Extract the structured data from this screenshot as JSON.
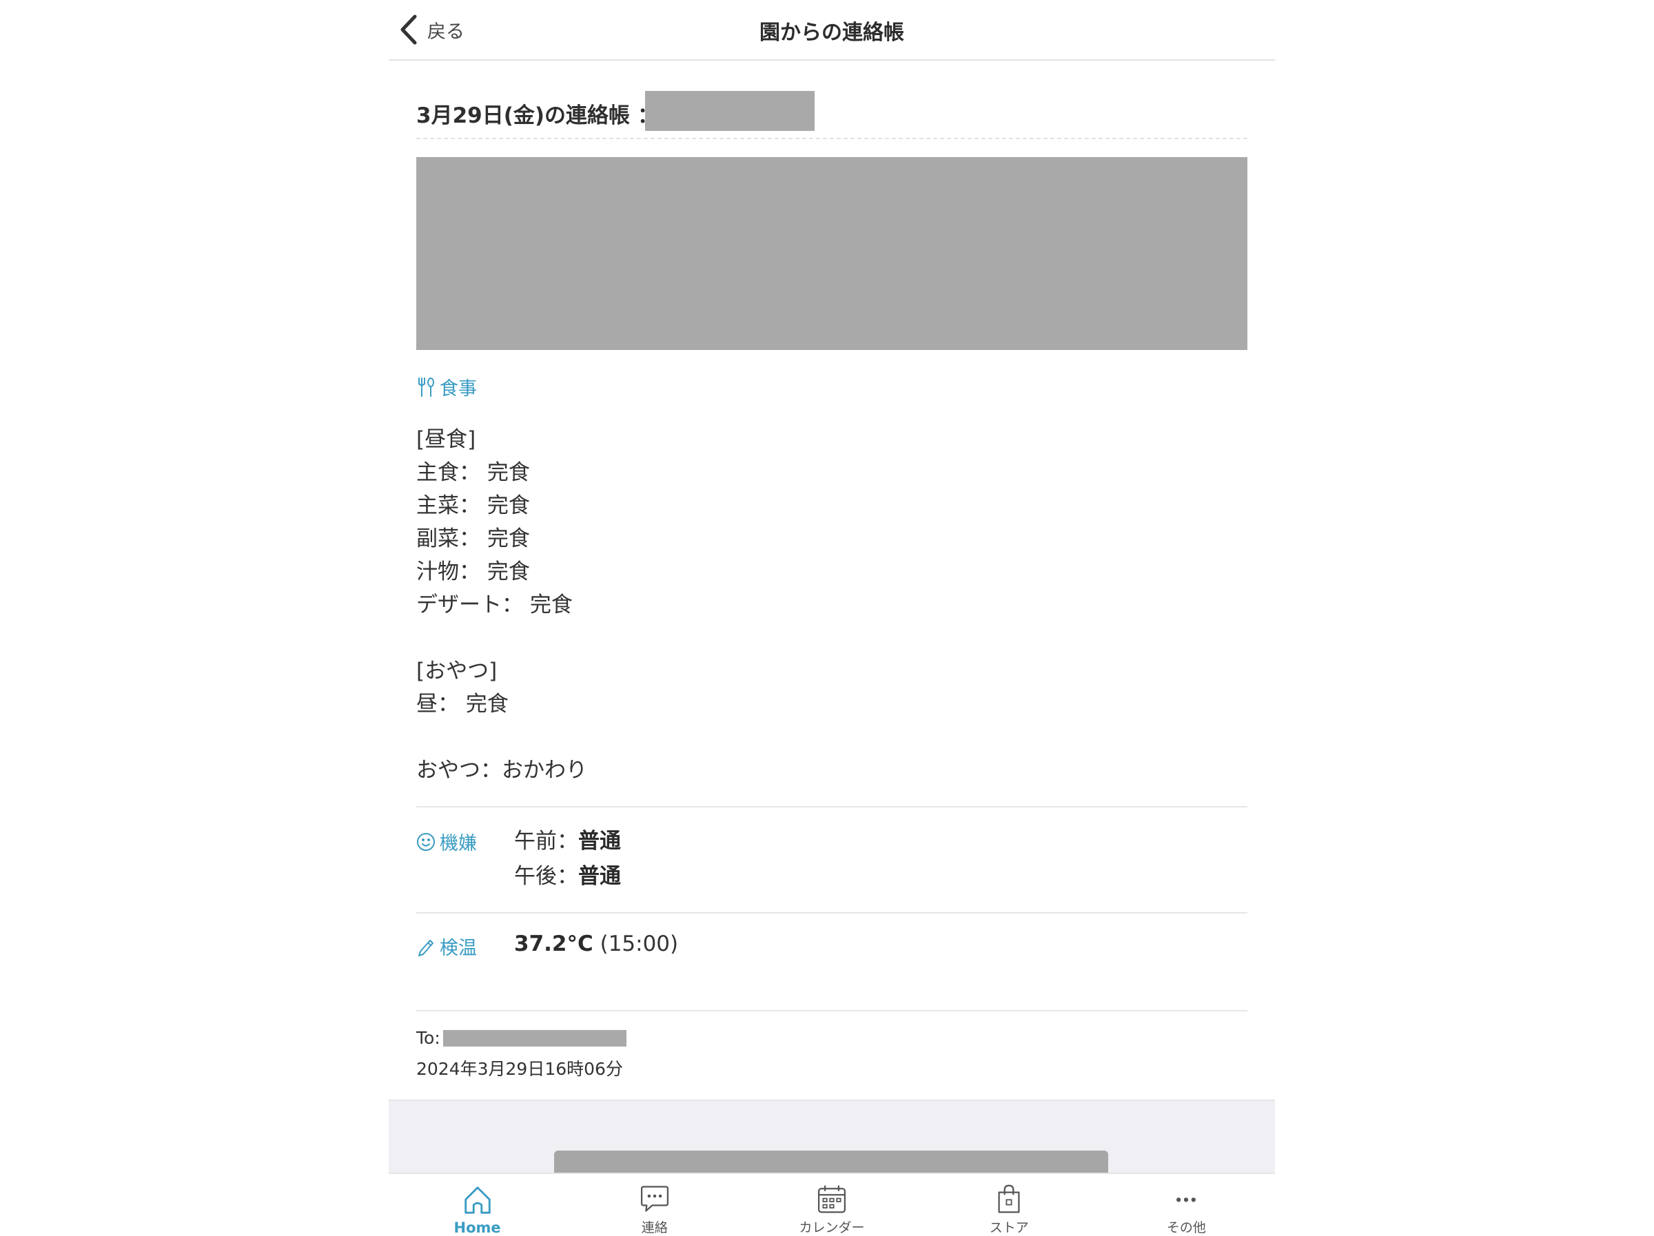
{
  "header": {
    "back_label": "戻る",
    "title": "園からの連絡帳"
  },
  "entry": {
    "title": "3月29日(金)の連絡帳 ："
  },
  "meal": {
    "label": "食事",
    "lines": [
      "[昼食]",
      "主食： 完食",
      "主菜： 完食",
      "副菜： 完食",
      "汁物： 完食",
      "デザート： 完食",
      "",
      "[おやつ]",
      "昼： 完食",
      "",
      "おやつ：おかわり"
    ]
  },
  "mood": {
    "label": "機嫌",
    "morning_key": "午前：",
    "morning_value": "普通",
    "afternoon_key": "午後：",
    "afternoon_value": "普通"
  },
  "temperature": {
    "label": "検温",
    "value": "37.2°C",
    "time": " (15:00)"
  },
  "meta": {
    "to_label": "To:",
    "date": "2024年3月29日16時06分"
  },
  "tabs": [
    {
      "label": "Home",
      "icon": "home-icon",
      "active": true
    },
    {
      "label": "連絡",
      "icon": "chat-icon",
      "active": false
    },
    {
      "label": "カレンダー",
      "icon": "calendar-icon",
      "active": false
    },
    {
      "label": "ストア",
      "icon": "store-bag-icon",
      "active": false
    },
    {
      "label": "その他",
      "icon": "more-icon",
      "active": false
    }
  ],
  "colors": {
    "accent": "#3a9cc3",
    "redaction": "#a9a9a9",
    "footer_bg": "#efeff4"
  }
}
